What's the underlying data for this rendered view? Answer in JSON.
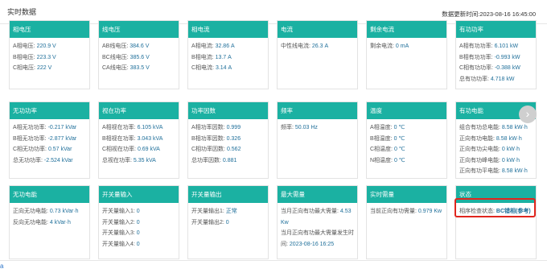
{
  "header": {
    "title": "实时数据",
    "update_label": "数据更新时间:",
    "update_time": "2023-08-16 16:45:00"
  },
  "cards": [
    {
      "title": "相电压",
      "rows": [
        {
          "label": "A相电压:",
          "value": "220.9 V"
        },
        {
          "label": "B相电压:",
          "value": "223.3 V"
        },
        {
          "label": "C相电压:",
          "value": "222 V"
        }
      ]
    },
    {
      "title": "线电压",
      "rows": [
        {
          "label": "AB线电压:",
          "value": "384.6 V"
        },
        {
          "label": "BC线电压:",
          "value": "385.6 V"
        },
        {
          "label": "CA线电压:",
          "value": "383.5 V"
        }
      ]
    },
    {
      "title": "相电流",
      "rows": [
        {
          "label": "A相电流:",
          "value": "32.86 A"
        },
        {
          "label": "B相电流:",
          "value": "13.7 A"
        },
        {
          "label": "C相电流:",
          "value": "3.14 A"
        }
      ]
    },
    {
      "title": "电流",
      "rows": [
        {
          "label": "中性线电流:",
          "value": "26.3 A"
        }
      ]
    },
    {
      "title": "剩余电流",
      "rows": [
        {
          "label": "剩余电流:",
          "value": "0 mA"
        }
      ]
    },
    {
      "title": "有功功率",
      "rows": [
        {
          "label": "A相有功功率:",
          "value": "6.101 kW"
        },
        {
          "label": "B相有功功率:",
          "value": "-0.993 kW"
        },
        {
          "label": "C相有功功率:",
          "value": "-0.388 kW"
        },
        {
          "label": "总有功功率:",
          "value": "4.718 kW"
        }
      ]
    },
    {
      "title": "无功功率",
      "rows": [
        {
          "label": "A相无功功率:",
          "value": "-0.217 kVar"
        },
        {
          "label": "B相无功功率:",
          "value": "-2.877 kVar"
        },
        {
          "label": "C相无功功率:",
          "value": "0.57 kVar"
        },
        {
          "label": "总无功功率:",
          "value": "-2.524 kVar"
        }
      ]
    },
    {
      "title": "视在功率",
      "rows": [
        {
          "label": "A相视在功率:",
          "value": "6.105 kVA"
        },
        {
          "label": "B相视在功率:",
          "value": "3.043 kVA"
        },
        {
          "label": "C相视在功率:",
          "value": "0.69 kVA"
        },
        {
          "label": "总视在功率:",
          "value": "5.35 kVA"
        }
      ]
    },
    {
      "title": "功率因数",
      "rows": [
        {
          "label": "A相功率因数:",
          "value": "0.999"
        },
        {
          "label": "B相功率因数:",
          "value": "0.326"
        },
        {
          "label": "C相功率因数:",
          "value": "0.562"
        },
        {
          "label": "总功率因数:",
          "value": "0.881"
        }
      ]
    },
    {
      "title": "频率",
      "rows": [
        {
          "label": "频率:",
          "value": "50.03 Hz"
        }
      ]
    },
    {
      "title": "温度",
      "rows": [
        {
          "label": "A相温度:",
          "value": "0 ℃"
        },
        {
          "label": "B相温度:",
          "value": "0 ℃"
        },
        {
          "label": "C相温度:",
          "value": "0 ℃"
        },
        {
          "label": "N相温度:",
          "value": "0 ℃"
        }
      ]
    },
    {
      "title": "有功电能",
      "rows": [
        {
          "label": "组合有功总电能:",
          "value": "8.58 kW·h"
        },
        {
          "label": "正向有功电能:",
          "value": "8.58 kW·h"
        },
        {
          "label": "正向有功尖电能:",
          "value": "0 kW·h"
        },
        {
          "label": "正向有功峰电能:",
          "value": "0 kW·h"
        },
        {
          "label": "正向有功平电能:",
          "value": "8.58 kW·h"
        },
        {
          "label": "正向有功谷电能:",
          "value": "0 kW·h"
        }
      ]
    },
    {
      "title": "无功电能",
      "rows": [
        {
          "label": "正向无功电能:",
          "value": "0.73 kVar·h"
        },
        {
          "label": "反向无功电能:",
          "value": "4 kVar·h"
        }
      ]
    },
    {
      "title": "开关量输入",
      "rows": [
        {
          "label": "开关量输入1:",
          "value": "0"
        },
        {
          "label": "开关量输入2:",
          "value": "0"
        },
        {
          "label": "开关量输入3:",
          "value": "0"
        },
        {
          "label": "开关量输入4:",
          "value": "0"
        }
      ]
    },
    {
      "title": "开关量输出",
      "rows": [
        {
          "label": "开关量输出1:",
          "value": "正常"
        },
        {
          "label": "开关量输出2:",
          "value": "0"
        }
      ]
    },
    {
      "title": "最大需量",
      "rows": [
        {
          "label": "当月正向有功最大需量:",
          "value": "4.53 Kw"
        },
        {
          "label": "当月正向有功最大需量发生时间:",
          "value": "2023-08-16 16:25"
        }
      ]
    },
    {
      "title": "实时需量",
      "rows": [
        {
          "label": "当前正向有功需量:",
          "value": "0.979 Kw"
        }
      ]
    },
    {
      "title": "状态",
      "rows": [
        {
          "label": "相序检查状态:",
          "value": "BC错相(参考)"
        }
      ]
    }
  ],
  "next_button": "›",
  "corner_text": "a"
}
